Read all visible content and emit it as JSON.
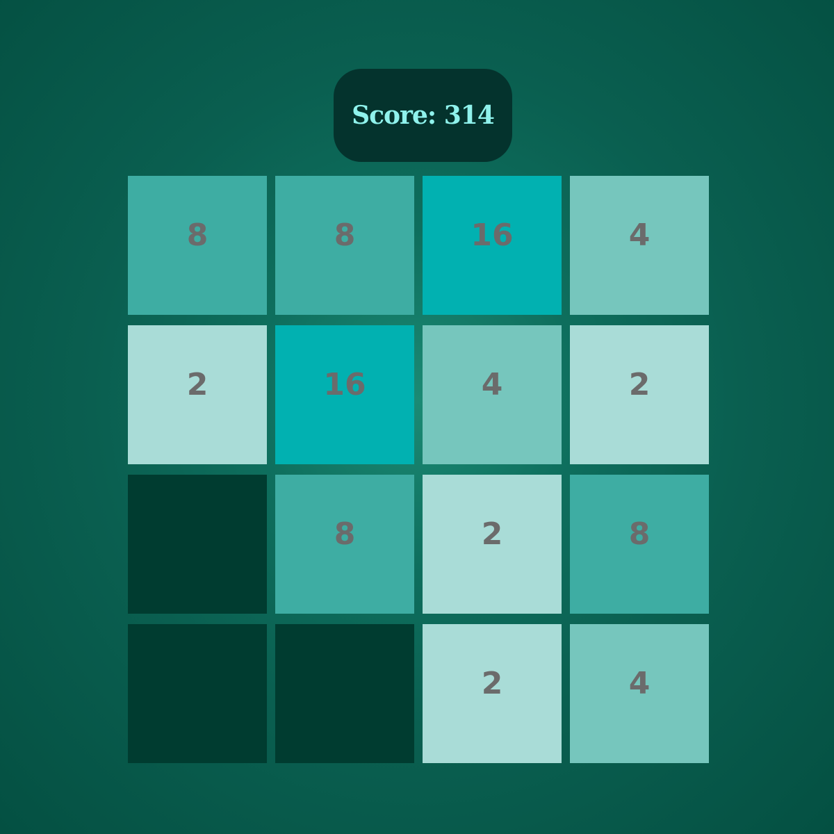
{
  "score": {
    "label": "Score: 314"
  },
  "colors": {
    "empty": "#003c30",
    "2": "#a9dcd7",
    "4": "#76c6bd",
    "8": "#3eada3",
    "16": "#01b1b1",
    "text": "#6b6b6b",
    "score_text": "#8ff2ec",
    "score_bg": "#04332d"
  },
  "board": {
    "rows": [
      [
        "8",
        "8",
        "16",
        "4"
      ],
      [
        "2",
        "16",
        "4",
        "2"
      ],
      [
        "",
        "8",
        "2",
        "8"
      ],
      [
        "",
        "",
        "2",
        "4"
      ]
    ]
  }
}
